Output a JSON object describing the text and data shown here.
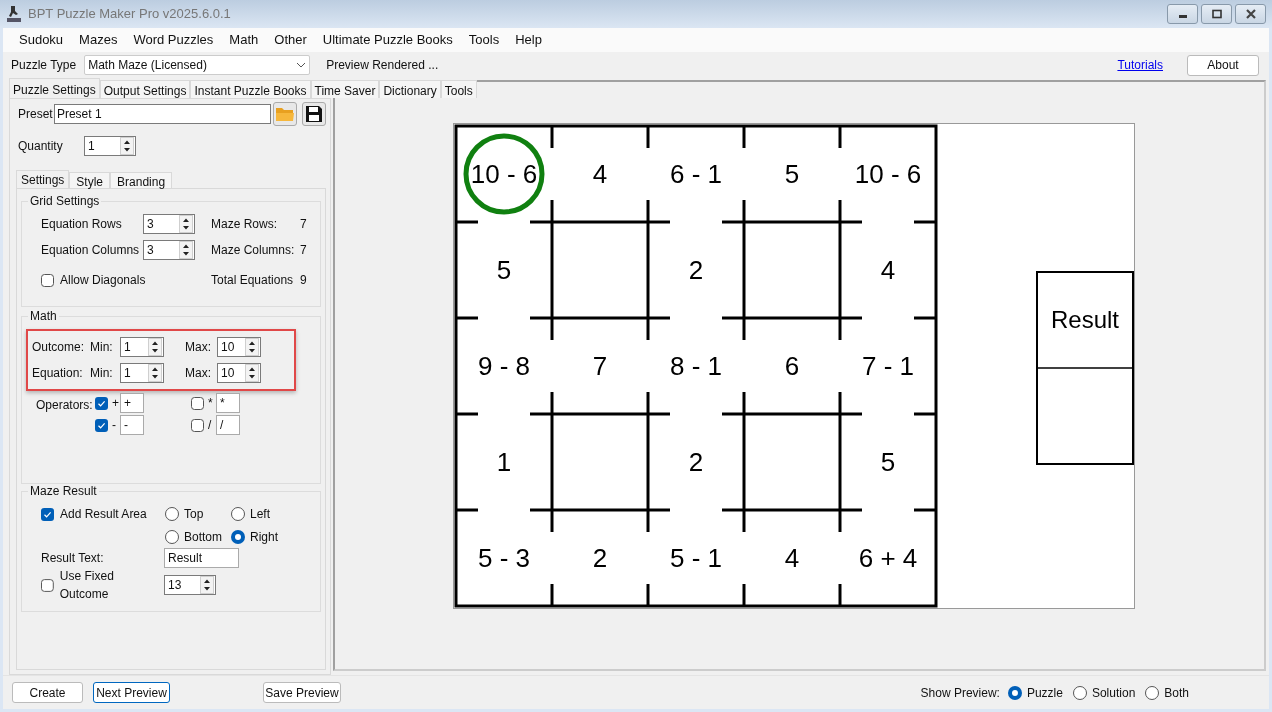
{
  "window": {
    "title": "BPT Puzzle Maker Pro v2025.6.0.1"
  },
  "menu": [
    "Sudoku",
    "Mazes",
    "Word Puzzles",
    "Math",
    "Other",
    "Ultimate Puzzle Books",
    "Tools",
    "Help"
  ],
  "toolbar": {
    "puzzle_type_label": "Puzzle Type",
    "puzzle_type": "Math Maze (Licensed)",
    "status": "Preview Rendered ...",
    "tutorials_link": "Tutorials",
    "about_button": "About"
  },
  "tabs": [
    {
      "label": "Puzzle Settings",
      "selected": true
    },
    {
      "label": "Output Settings",
      "selected": false
    },
    {
      "label": "Instant Puzzle Books",
      "selected": false
    },
    {
      "label": "Time Saver",
      "selected": false
    },
    {
      "label": "Dictionary",
      "selected": false
    },
    {
      "label": "Tools",
      "selected": false
    }
  ],
  "preset": {
    "label": "Preset",
    "value": "Preset 1"
  },
  "quantity": {
    "label": "Quantity",
    "value": "1"
  },
  "inner_tabs": [
    {
      "label": "Settings",
      "selected": true
    },
    {
      "label": "Style",
      "selected": false
    },
    {
      "label": "Branding",
      "selected": false
    }
  ],
  "grid_settings": {
    "title": "Grid Settings",
    "equation_rows": {
      "label": "Equation Rows",
      "value": "3"
    },
    "equation_columns": {
      "label": "Equation Columns",
      "value": "3"
    },
    "allow_diagonals": {
      "label": "Allow Diagonals",
      "checked": false
    },
    "readouts": [
      {
        "label": "Maze Rows:",
        "value": "7"
      },
      {
        "label": "Maze Columns:",
        "value": "7"
      },
      {
        "label": "Total Equations",
        "value": "9"
      }
    ]
  },
  "math": {
    "title": "Math",
    "highlighted": true,
    "ranges": [
      {
        "label": "Outcome:",
        "min_label": "Min:",
        "min": "1",
        "max_label": "Max:",
        "max": "10"
      },
      {
        "label": "Equation:",
        "min_label": "Min:",
        "min": "1",
        "max_label": "Max:",
        "max": "10"
      }
    ],
    "operators_label": "Operators:",
    "operators": [
      {
        "label": "+",
        "value": "+",
        "checked": true
      },
      {
        "label": "*",
        "value": "*",
        "checked": false
      },
      {
        "label": "-",
        "value": "-",
        "checked": true
      },
      {
        "label": "/",
        "value": "/",
        "checked": false
      }
    ]
  },
  "maze_result": {
    "title": "Maze Result",
    "add_result_area": {
      "label": "Add Result Area",
      "checked": true
    },
    "positions": [
      {
        "label": "Top",
        "selected": false
      },
      {
        "label": "Left",
        "selected": false
      },
      {
        "label": "Bottom",
        "selected": false
      },
      {
        "label": "Right",
        "selected": true
      }
    ],
    "result_text": {
      "label": "Result Text:",
      "value": "Result"
    },
    "fixed_outcome": {
      "label": "Use Fixed Outcome",
      "checked": false,
      "value": "13"
    }
  },
  "maze": {
    "result_label": "Result",
    "cells": [
      [
        {
          "kind": "text",
          "text": "10 - 6",
          "highlighted": true
        },
        {
          "kind": "text",
          "text": "4",
          "highlighted": false
        },
        {
          "kind": "text",
          "text": "6 - 1",
          "highlighted": false
        },
        {
          "kind": "text",
          "text": "5",
          "highlighted": false
        },
        {
          "kind": "text",
          "text": "10 - 6",
          "highlighted": false
        }
      ],
      [
        {
          "kind": "text",
          "text": "5",
          "highlighted": false
        },
        {
          "kind": "blank"
        },
        {
          "kind": "text",
          "text": "2",
          "highlighted": false
        },
        {
          "kind": "blank"
        },
        {
          "kind": "text",
          "text": "4",
          "highlighted": false
        }
      ],
      [
        {
          "kind": "text",
          "text": "9 - 8",
          "highlighted": false
        },
        {
          "kind": "text",
          "text": "7",
          "highlighted": false
        },
        {
          "kind": "text",
          "text": "8 - 1",
          "highlighted": false
        },
        {
          "kind": "text",
          "text": "6",
          "highlighted": false
        },
        {
          "kind": "text",
          "text": "7 - 1",
          "highlighted": false
        }
      ],
      [
        {
          "kind": "text",
          "text": "1",
          "highlighted": false
        },
        {
          "kind": "blank"
        },
        {
          "kind": "text",
          "text": "2",
          "highlighted": false
        },
        {
          "kind": "blank"
        },
        {
          "kind": "text",
          "text": "5",
          "highlighted": false
        }
      ],
      [
        {
          "kind": "text",
          "text": "5 - 3",
          "highlighted": false
        },
        {
          "kind": "text",
          "text": "2",
          "highlighted": false
        },
        {
          "kind": "text",
          "text": "5 - 1",
          "highlighted": false
        },
        {
          "kind": "text",
          "text": "4",
          "highlighted": false
        },
        {
          "kind": "text",
          "text": "6 + 4",
          "highlighted": false
        }
      ]
    ]
  },
  "bottom": {
    "buttons": [
      {
        "label": "Create",
        "kind": "plain"
      },
      {
        "label": "Next Preview",
        "kind": "focused"
      }
    ],
    "save_preview": "Save Preview",
    "show_preview_label": "Show Preview:",
    "show_preview": [
      {
        "label": "Puzzle",
        "selected": true
      },
      {
        "label": "Solution",
        "selected": false
      },
      {
        "label": "Both",
        "selected": false
      }
    ]
  }
}
